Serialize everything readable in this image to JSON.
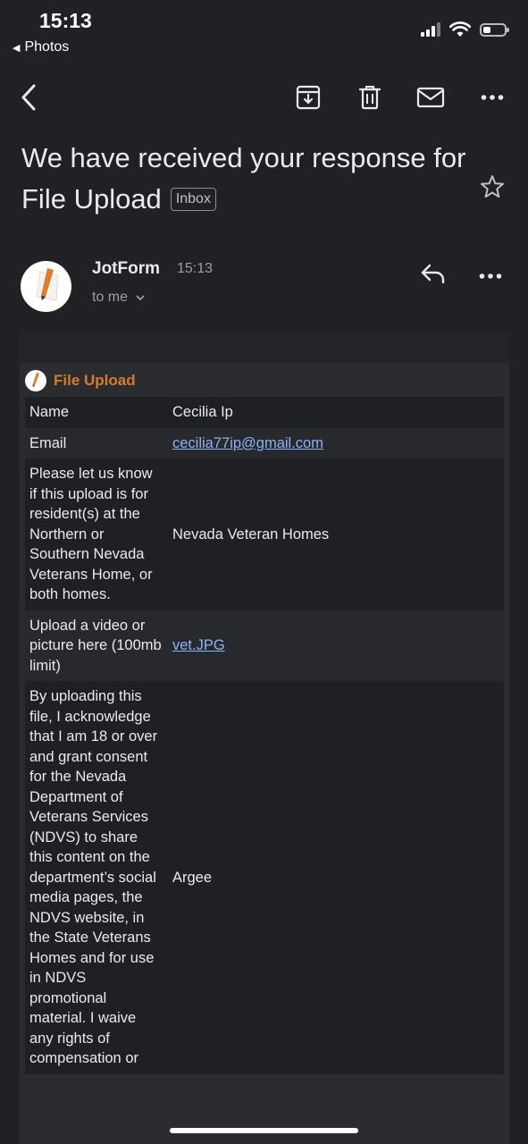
{
  "status_bar": {
    "time": "15:13",
    "back_app": "Photos"
  },
  "toolbar": {
    "icons": [
      "back-arrow-icon",
      "archive-icon",
      "trash-icon",
      "mail-icon",
      "more-icon"
    ]
  },
  "email": {
    "subject": "We have received your response for File Upload",
    "label": "Inbox",
    "sender": "JotForm",
    "time": "15:13",
    "to": "to me"
  },
  "form": {
    "title": "File Upload",
    "rows": [
      {
        "label": "Name",
        "value": "Cecilia Ip"
      },
      {
        "label": "Email",
        "value": "cecilia77ip@gmail.com"
      },
      {
        "label": "Please let us know if this upload is for resident(s) at the Northern or Southern Nevada Veterans Home, or both homes.",
        "value": "Nevada Veteran Homes"
      },
      {
        "label": "Upload a video or picture here (100mb limit)",
        "value": "vet.JPG"
      },
      {
        "label": "By uploading this file, I acknowledge that I am 18 or over and grant consent for the Nevada Department of Veterans Services (NDVS) to share this content on the department’s social media pages, the NDVS website, in the State Veterans Homes and for use in NDVS promotional material. I waive any rights of compensation or",
        "value": "Argee"
      }
    ]
  },
  "colors": {
    "background": "#202124",
    "accent": "#d57c2a",
    "link": "#8ab4f8"
  }
}
